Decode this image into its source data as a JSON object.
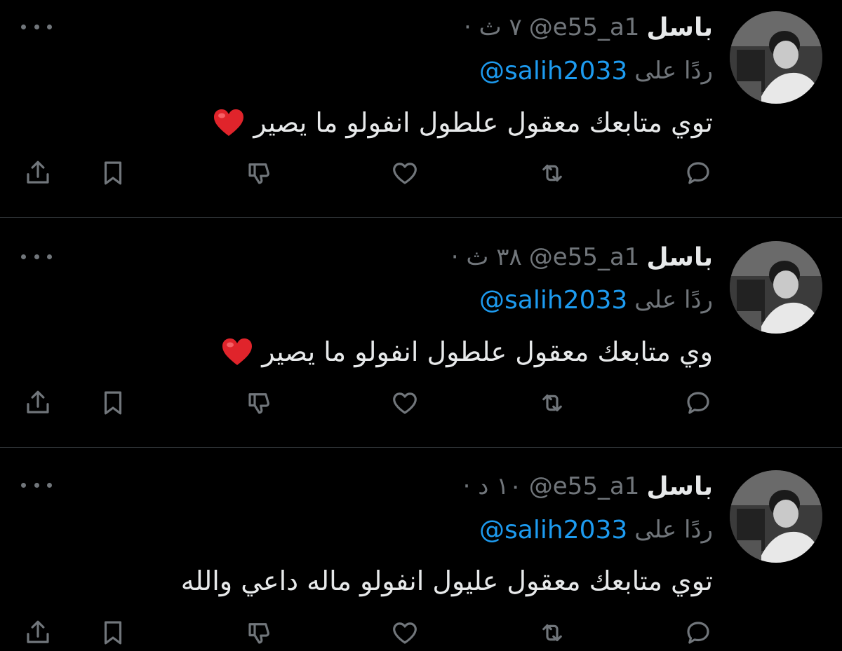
{
  "tweets": [
    {
      "name": "باسل",
      "handle": "@e55_a1",
      "time": "· ٧ ث",
      "reply_prefix": "ردًا على",
      "reply_to": "@salih2033",
      "text": "توي متابعك معقول علطول انفولو ما يصير",
      "has_heart_emoji": true
    },
    {
      "name": "باسل",
      "handle": "@e55_a1",
      "time": "· ٣٨ ث",
      "reply_prefix": "ردًا على",
      "reply_to": "@salih2033",
      "text": "وي متابعك معقول علطول انفولو ما يصير",
      "has_heart_emoji": true
    },
    {
      "name": "باسل",
      "handle": "@e55_a1",
      "time": "· ١٠ د",
      "reply_prefix": "ردًا على",
      "reply_to": "@salih2033",
      "text": "توي متابعك معقول عليول انفولو ماله داعي والله",
      "has_heart_emoji": false
    }
  ],
  "actions": [
    "reply-icon",
    "retweet-icon",
    "like-icon",
    "dislike-icon",
    "bookmark-icon",
    "share-icon"
  ],
  "colors": {
    "background": "#000000",
    "text": "#e7e9ea",
    "muted": "#71767b",
    "link": "#1d9bf0",
    "divider": "#2f3336",
    "heart": "#e0242b"
  }
}
